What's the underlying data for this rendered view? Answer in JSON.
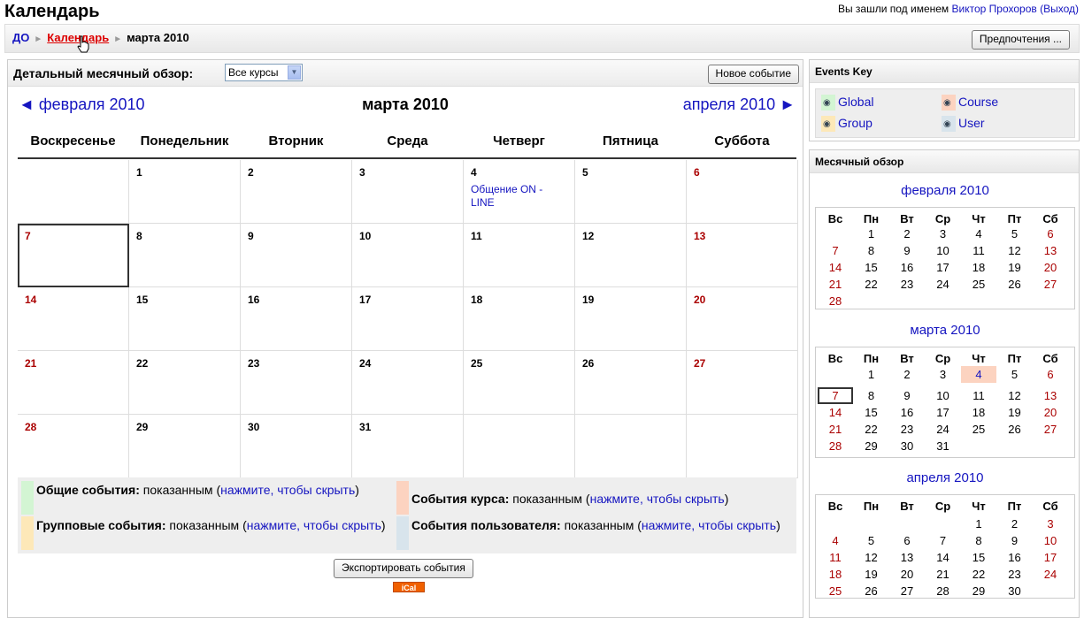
{
  "header": {
    "title": "Календарь",
    "login_text": "Вы зашли под именем",
    "user_name": "Виктор Прохоров",
    "logout": "(Выход)"
  },
  "navbar": {
    "crumb_home": "ДО",
    "crumb_calendar": "Календарь",
    "crumb_current": "марта 2010",
    "preferences_button": "Предпочтения ..."
  },
  "main": {
    "detail_label": "Детальный месячный обзор:",
    "course_select": "Все курсы",
    "new_event_button": "Новое событие",
    "prev_month": "◄ февраля 2010",
    "current_month": "марта 2010",
    "next_month": "апреля 2010 ►",
    "weekdays": [
      "Воскресенье",
      "Понедельник",
      "Вторник",
      "Среда",
      "Четверг",
      "Пятница",
      "Суббота"
    ],
    "event_text": "Общение ON - LINE",
    "export_button": "Экспортировать события",
    "ical_badge": "iCal"
  },
  "legend": {
    "global_label": "Общие события:",
    "global_state": "показанным (",
    "global_link": "нажмите, чтобы скрыть",
    "global_close": ")",
    "course_label": "События курса:",
    "course_state": "показанным (",
    "course_link": "нажмите, чтобы скрыть",
    "course_close": ")",
    "group_label": "Групповые события:",
    "group_state": "показанным (",
    "group_link": "нажмите, чтобы скрыть",
    "group_close": ")",
    "user_label": "События пользователя:",
    "user_state": "показанным (",
    "user_link": "нажмите, чтобы скрыть",
    "user_close": ")"
  },
  "events_key": {
    "title": "Events Key",
    "global": "Global",
    "course": "Course",
    "group": "Group",
    "user": "User"
  },
  "overview": {
    "title": "Месячный обзор",
    "feb_title": "февраля 2010",
    "mar_title": "марта 2010",
    "apr_title": "апреля 2010",
    "short_days": [
      "Вс",
      "Пн",
      "Вт",
      "Ср",
      "Чт",
      "Пт",
      "Сб"
    ]
  },
  "colors": {
    "link": "#1515c0",
    "weekend": "#aa0000",
    "global": "#d3f5d3",
    "course": "#fcd3c0",
    "group": "#fde8b8",
    "user": "#d8e4ec"
  },
  "icons": [
    "cursor-icon",
    "eye-icon",
    "select-arrow-icon"
  ]
}
